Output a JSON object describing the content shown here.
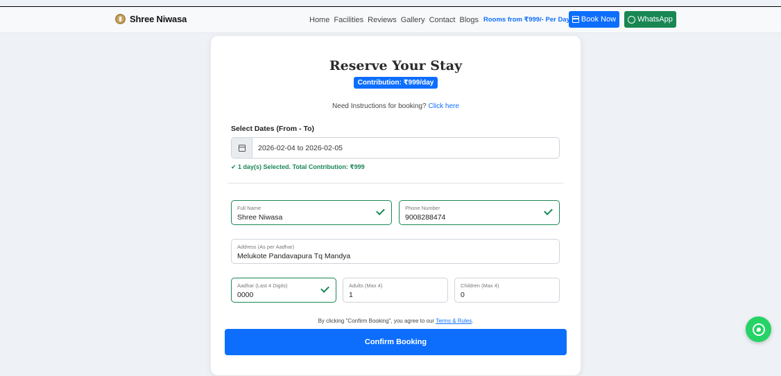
{
  "nav": {
    "brand": "Shree Niwasa",
    "links": [
      "Home",
      "Facilities",
      "Reviews",
      "Gallery",
      "Contact",
      "Blogs"
    ],
    "rooms_from": "Rooms from ₹999/- Per Day",
    "book_now": "Book Now",
    "whatsapp": "WhatsApp"
  },
  "form": {
    "title": "Reserve Your Stay",
    "contribution_badge": "Contribution: ₹999/day",
    "instructions_text": "Need Instructions for booking?",
    "instructions_link": "Click here",
    "dates_label": "Select Dates (From - To)",
    "dates_value": "2026-02-04 to 2026-02-05",
    "selected_msg": "✔ 1 day(s) Selected. Total Contribution: ₹999",
    "full_name": {
      "label": "Full Name",
      "value": "Shree Niwasa"
    },
    "phone": {
      "label": "Phone Number",
      "value": "9008288474"
    },
    "address": {
      "label": "Address (As per Aadhar)",
      "value": "Melukote Pandavapura Tq Mandya"
    },
    "aadhar": {
      "label": "Aadhar (Last 4 Digits)",
      "value": "0000"
    },
    "adults": {
      "label": "Adults (Max 4)",
      "value": "1"
    },
    "children": {
      "label": "Children (Max 4)",
      "value": "0"
    },
    "agree_text": "By clicking \"Confirm Booking\", you agree to our",
    "terms_link": "Terms & Rules",
    "agree_suffix": ".",
    "confirm_label": "Confirm Booking"
  },
  "colors": {
    "primary": "#0d6efd",
    "success": "#198754",
    "whatsapp_float": "#25d366"
  },
  "icons": {
    "brand": "om-logo-icon",
    "book": "calendar-icon",
    "whatsapp": "whatsapp-icon",
    "date_addon": "calendar-icon",
    "valid": "check-icon"
  }
}
